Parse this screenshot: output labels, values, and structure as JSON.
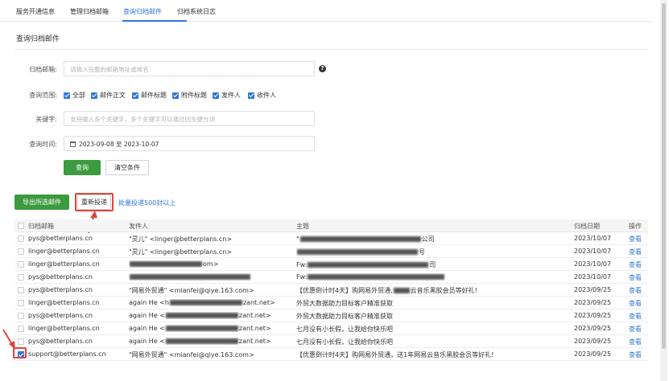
{
  "nav": {
    "tabs": [
      {
        "label": "服务开通信息"
      },
      {
        "label": "管理归档邮箱"
      },
      {
        "label": "查询归档邮件"
      },
      {
        "label": "归档系统日志"
      }
    ]
  },
  "page": {
    "title": "查询归档邮件"
  },
  "form": {
    "mailbox_label": "归档邮箱:",
    "mailbox_placeholder": "请输入完整的邮箱地址或域名",
    "scope_label": "查询范围:",
    "scope_options": [
      "全部",
      "邮件正文",
      "邮件标题",
      "附件标题",
      "发件人",
      "收件人"
    ],
    "keyword_label": "关键字:",
    "keyword_placeholder": "支持输入多个关键字，多个关键字可以通过回车键分词",
    "time_label": "查询时间:",
    "time_value": "2023-09-08 至 2023-10-07",
    "search_button": "查询",
    "clear_button": "清空条件"
  },
  "actions": {
    "export_button": "导出所选邮件",
    "redeliver_button": "重新投递",
    "bulk_link": "批量投递500封以上"
  },
  "table": {
    "headers": {
      "mailbox": "归档邮箱",
      "sender": "发件人",
      "subject": "主题",
      "date": "归档日期",
      "action": "操作"
    },
    "rows": [
      {
        "mailbox": "pys@betterplans.cn",
        "sender": "\"灵儿\" <linger@betterplans.cn>",
        "subject": "\"",
        "subject_tail": "公司",
        "date": "2023/10/07",
        "action": "查看",
        "checked": false
      },
      {
        "mailbox": "linger@betterplans.cn",
        "sender": "\"灵儿\" <linger@betterplans.cn>",
        "subject": "",
        "subject_tail": "号",
        "date": "2023/10/07",
        "action": "查看",
        "checked": false
      },
      {
        "mailbox": "linger@betterplans.cn",
        "sender": "",
        "sender_tail": "om>",
        "subject": "Fw:",
        "subject_tail": "司",
        "date": "2023/10/07",
        "action": "查看",
        "checked": false
      },
      {
        "mailbox": "pys@betterplans.cn",
        "sender": "",
        "sender_tail": "",
        "subject": "Fw:",
        "subject_tail": "",
        "date": "2023/10/07",
        "action": "查看",
        "checked": false
      },
      {
        "mailbox": "pys@betterplans.cn",
        "sender": "\"网易外贸通\" <mianfei@qiye.163.com>",
        "subject": "【优惠倒计时4天】购网易外贸通,",
        "subject_tail": "云音乐黑胶会员等好礼!",
        "date": "2023/09/25",
        "action": "查看",
        "checked": false
      },
      {
        "mailbox": "linger@betterplans.cn",
        "sender": "again He <h",
        "sender_tail": "zant.net>",
        "subject": "外贸大数据助力目标客户精准获取",
        "subject_tail": "",
        "date": "2023/09/25",
        "action": "查看",
        "checked": false
      },
      {
        "mailbox": "pys@betterplans.cn",
        "sender": "again He <",
        "sender_tail": "zant.net>",
        "subject": "外贸大数据助力目标客户精准获取",
        "subject_tail": "",
        "date": "2023/09/25",
        "action": "查看",
        "checked": false
      },
      {
        "mailbox": "linger@betterplans.cn",
        "sender": "again He <",
        "sender_tail": "zant.net>",
        "subject": "七月没有小长假，让我给你快乐吧",
        "subject_tail": "",
        "date": "2023/09/25",
        "action": "查看",
        "checked": false
      },
      {
        "mailbox": "pys@betterplans.cn",
        "sender": "again He <",
        "sender_tail": "zant.net>",
        "subject": "七月没有小长假，让我给你快乐吧",
        "subject_tail": "",
        "date": "2023/09/25",
        "action": "查看",
        "checked": false
      },
      {
        "mailbox": "support@betterplans.cn",
        "sender": "\"网易外贸通\" <mianfei@qiye.163.com>",
        "subject": "【优惠倒计时4天】购网易外贸通，送1年网易云音乐黑胶会员等好礼!",
        "subject_tail": "",
        "date": "2023/09/25",
        "action": "查看",
        "checked": true
      }
    ]
  },
  "colors": {
    "accent": "#2f77d9",
    "primary_button": "#3c9a3f",
    "highlight": "#e0453a"
  }
}
